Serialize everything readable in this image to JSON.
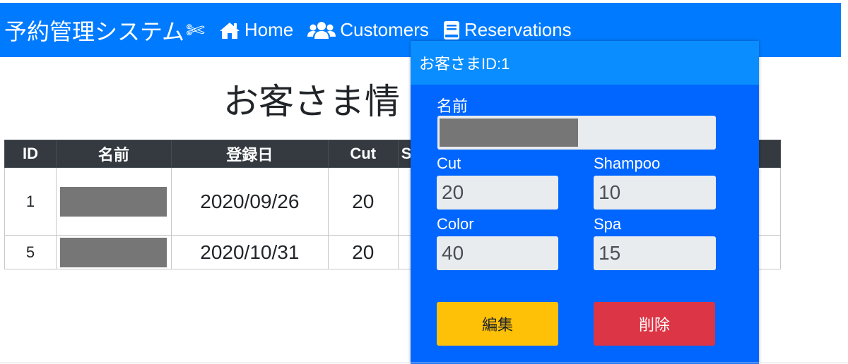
{
  "navbar": {
    "brand": "予約管理システム",
    "brand_icon": "scissors-icon",
    "links": [
      {
        "label": "Home",
        "icon": "home-icon"
      },
      {
        "label": "Customers",
        "icon": "users-icon"
      },
      {
        "label": "Reservations",
        "icon": "book-icon"
      }
    ],
    "color": "#007bff"
  },
  "page": {
    "title": "お客さま情"
  },
  "table": {
    "headers": [
      "ID",
      "名前",
      "登録日",
      "Cut",
      "S"
    ],
    "rows": [
      {
        "id": "1",
        "name": "",
        "date": "2020/09/26",
        "cut": "20"
      },
      {
        "id": "5",
        "name": "",
        "date": "2020/10/31",
        "cut": "20"
      }
    ]
  },
  "modal": {
    "title": "お客さまID:1",
    "name_label": "名前",
    "name_value": "",
    "cut_label": "Cut",
    "cut_value": "20",
    "shampoo_label": "Shampoo",
    "shampoo_value": "10",
    "color_label": "Color",
    "color_value": "40",
    "spa_label": "Spa",
    "spa_value": "15",
    "edit_label": "編集",
    "delete_label": "削除",
    "colors": {
      "body": "#0066ff",
      "header": "#0a8dff",
      "edit": "#ffc107",
      "delete": "#dc3545"
    }
  }
}
